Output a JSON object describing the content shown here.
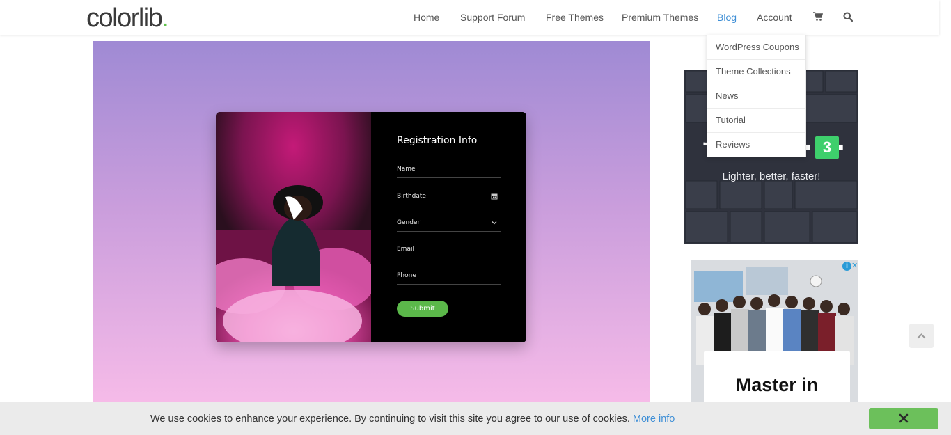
{
  "header": {
    "logo_text": "colorlib",
    "logo_dot": ".",
    "nav": {
      "home": "Home",
      "support": "Support Forum",
      "free_themes": "Free Themes",
      "premium_themes": "Premium Themes",
      "blog": "Blog",
      "account": "Account"
    },
    "icons": {
      "cart": "shopping-cart-icon",
      "search": "search-icon"
    }
  },
  "blog_dropdown": {
    "items": [
      "WordPress Coupons",
      "Theme Collections",
      "News",
      "Tutorial",
      "Reviews"
    ]
  },
  "registration_form": {
    "title": "Registration Info",
    "fields": {
      "name": "Name",
      "birthdate": "Birthdate",
      "gender": "Gender",
      "email": "Email",
      "phone": "Phone"
    },
    "submit_label": "Submit"
  },
  "ad_zerif": {
    "badge": "3",
    "tagline": "Lighter, better, faster!"
  },
  "ad_master": {
    "title": "Master in"
  },
  "cookie_bar": {
    "text": "We use cookies to enhance your experience. By continuing to visit this site you agree to our use of cookies.",
    "link": "More info"
  },
  "colors": {
    "accent_blue": "#3f8fd6",
    "brand_green": "#5fc14a",
    "submit_green": "#5bb84a",
    "cookie_close": "#6cc05b"
  }
}
